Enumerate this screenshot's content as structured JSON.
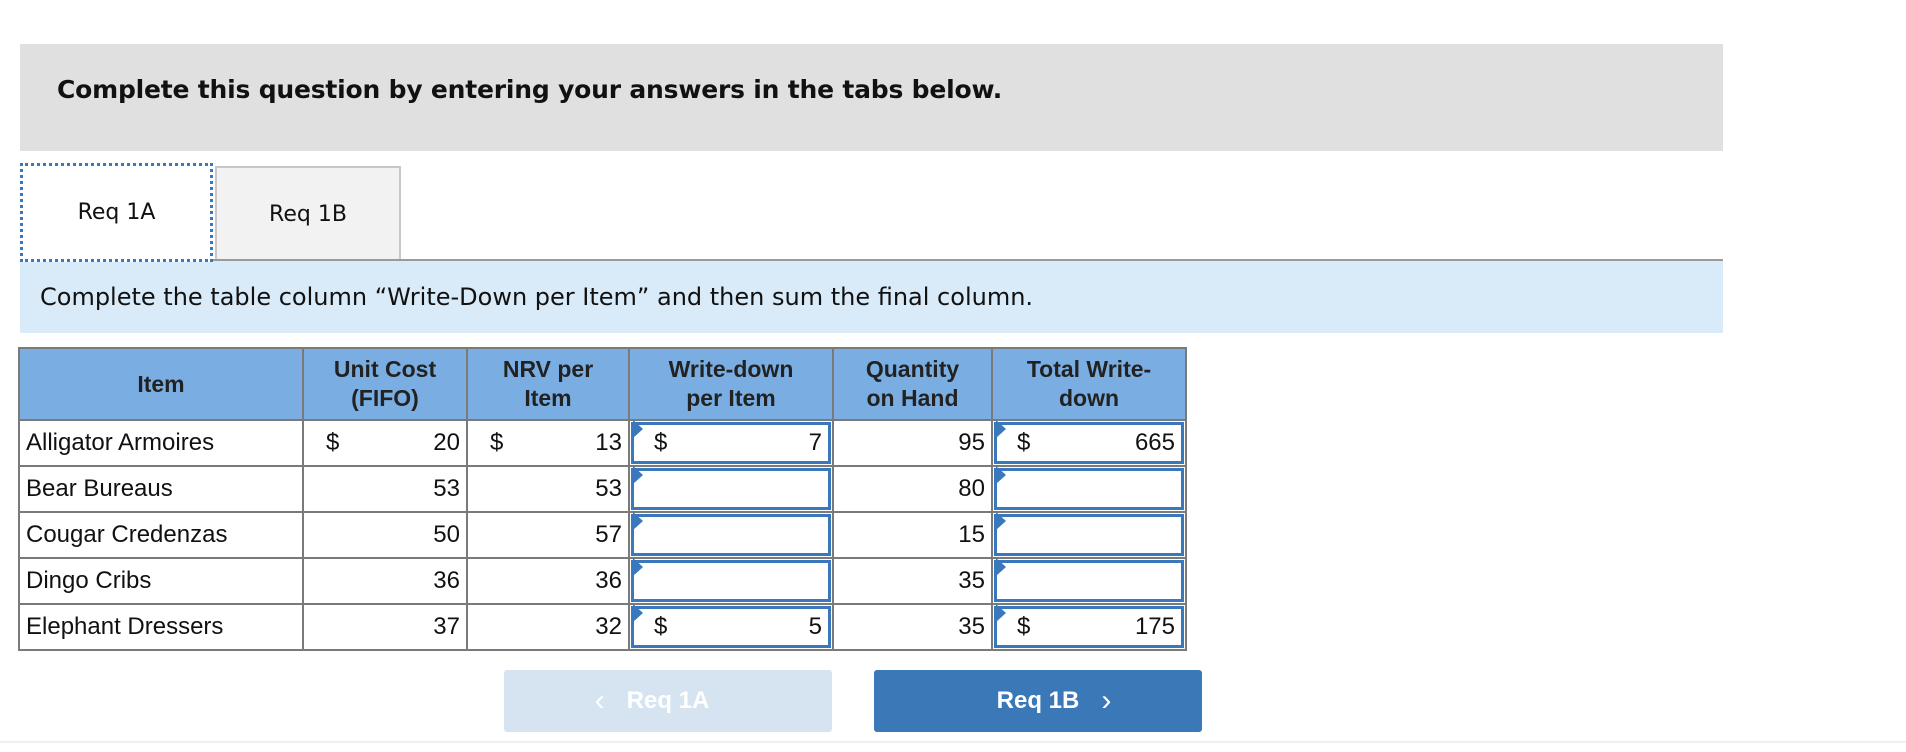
{
  "banner": {
    "text": "Complete this question by entering your answers in the tabs below."
  },
  "tabs": [
    {
      "label": "Req 1A",
      "active": true
    },
    {
      "label": "Req 1B",
      "active": false
    }
  ],
  "instruction": "Complete the table column “Write-Down per Item” and then sum the final column.",
  "table": {
    "headers": [
      "Item",
      "Unit Cost (FIFO)",
      "NRV per Item",
      "Write-down per Item",
      "Quantity on Hand",
      "Total Write-down"
    ],
    "header_lines": [
      [
        "Item"
      ],
      [
        "Unit Cost",
        "(FIFO)"
      ],
      [
        "NRV per",
        "Item"
      ],
      [
        "Write-down",
        "per Item"
      ],
      [
        "Quantity",
        "on Hand"
      ],
      [
        "Total Write-",
        "down"
      ]
    ],
    "currency_symbol": "$",
    "rows": [
      {
        "item": "Alligator Armoires",
        "unit_cost": "20",
        "nrv": "13",
        "writedown": "7",
        "qty": "95",
        "total": "665",
        "show_dollar": true
      },
      {
        "item": "Bear Bureaus",
        "unit_cost": "53",
        "nrv": "53",
        "writedown": "",
        "qty": "80",
        "total": "",
        "show_dollar": false
      },
      {
        "item": "Cougar Credenzas",
        "unit_cost": "50",
        "nrv": "57",
        "writedown": "",
        "qty": "15",
        "total": "",
        "show_dollar": false
      },
      {
        "item": "Dingo Cribs",
        "unit_cost": "36",
        "nrv": "36",
        "writedown": "",
        "qty": "35",
        "total": "",
        "show_dollar": false
      },
      {
        "item": "Elephant Dressers",
        "unit_cost": "37",
        "nrv": "32",
        "writedown": "5",
        "qty": "35",
        "total": "175",
        "show_dollar": true
      }
    ]
  },
  "nav": {
    "prev_label": "Req 1A",
    "next_label": "Req 1B",
    "prev_icon": "chevron-left-icon",
    "next_icon": "chevron-right-icon"
  },
  "colors": {
    "header_bg": "#7aaee2",
    "input_border": "#3a78bd",
    "next_button": "#3a78b8",
    "prev_button_disabled": "#d6e4f2",
    "instruction_bg": "#d9eaf8",
    "banner_bg": "#e0e0e0"
  }
}
